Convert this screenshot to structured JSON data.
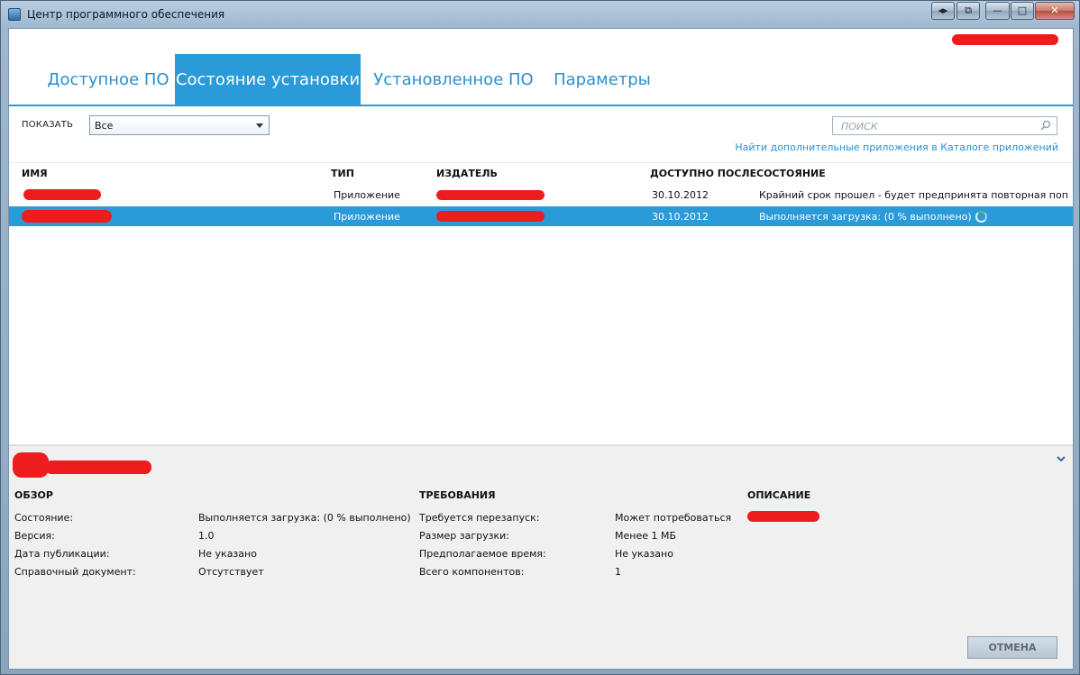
{
  "window": {
    "title": "Центр программного обеспечения",
    "icon": "software-center-icon",
    "controls": {
      "nav": "◂▸",
      "snap": "⧉",
      "minimize": "—",
      "maximize": "□",
      "close": "✕"
    }
  },
  "tabs": [
    {
      "label": "Доступное ПО",
      "active": false
    },
    {
      "label": "Состояние установки",
      "active": true
    },
    {
      "label": "Установленное ПО",
      "active": false
    },
    {
      "label": "Параметры",
      "active": false
    }
  ],
  "filter": {
    "label": "ПОКАЗАТЬ",
    "selected": "Все"
  },
  "search": {
    "placeholder": "ПОИСК",
    "icon": "search-icon"
  },
  "catalog_link": "Найти дополнительные приложения в Каталоге приложений",
  "table": {
    "columns": [
      "ИМЯ",
      "ТИП",
      "ИЗДАТЕЛЬ",
      "ДОСТУПНО ПОСЛЕ",
      "СОСТОЯНИЕ"
    ],
    "rows": [
      {
        "type": "Приложение",
        "available_after": "30.10.2012",
        "status": "Крайний срок прошел - будет предпринята повторная попытка",
        "selected": false
      },
      {
        "type": "Приложение",
        "available_after": "30.10.2012",
        "status": "Выполняется загрузка: (0 % выполнено)",
        "selected": true
      }
    ]
  },
  "details": {
    "overview": {
      "title": "ОБЗОР",
      "items": [
        {
          "label": "Состояние:",
          "value": "Выполняется загрузка: (0 % выполнено)"
        },
        {
          "label": "Версия:",
          "value": "1.0"
        },
        {
          "label": "Дата публикации:",
          "value": "Не указано"
        },
        {
          "label": "Справочный документ:",
          "value": "Отсутствует"
        }
      ]
    },
    "requirements": {
      "title": "ТРЕБОВАНИЯ",
      "items": [
        {
          "label": "Требуется перезапуск:",
          "value": "Может потребоваться"
        },
        {
          "label": "Размер загрузки:",
          "value": "Менее 1 МБ"
        },
        {
          "label": "Предполагаемое время:",
          "value": "Не указано"
        },
        {
          "label": "Всего компонентов:",
          "value": "1"
        }
      ]
    },
    "description": {
      "title": "ОПИСАНИЕ"
    },
    "cancel_label": "ОТМЕНА"
  },
  "colors": {
    "accent": "#2b9ad8",
    "redaction": "#ee1c1c",
    "details_bg": "#f0f0f0"
  }
}
